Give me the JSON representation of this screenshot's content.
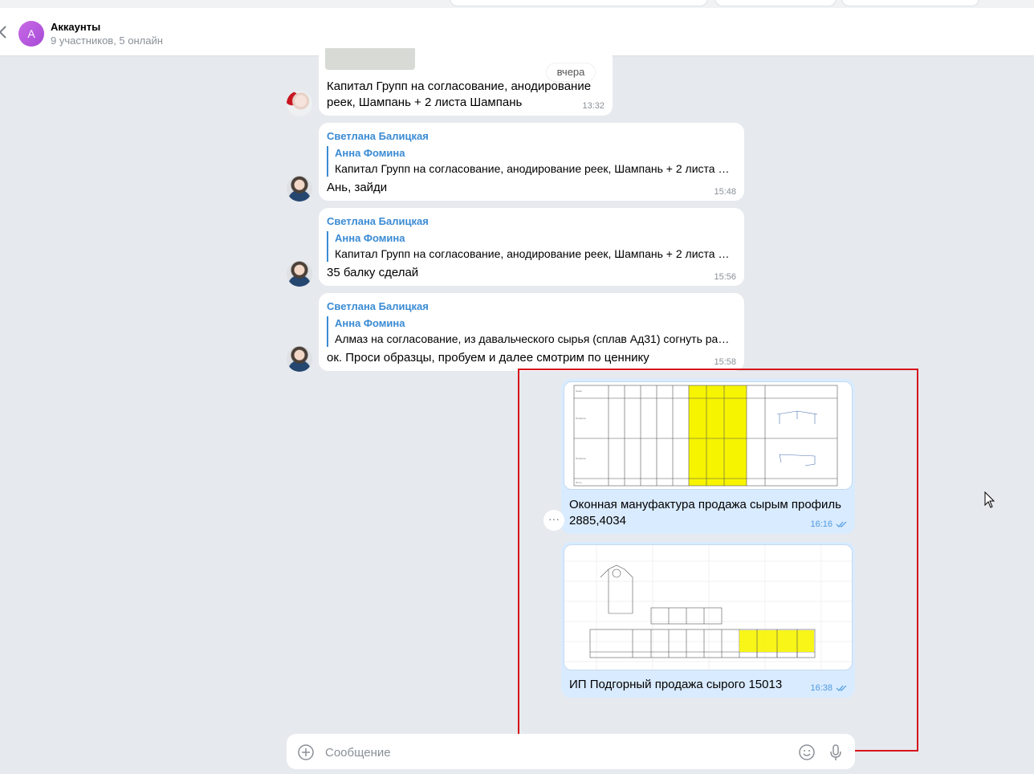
{
  "header": {
    "avatar_letter": "А",
    "title": "Аккаунты",
    "subtitle": "9 участников, 5 онлайн"
  },
  "date_chip": "вчера",
  "messages": [
    {
      "text": "Капитал Групп на согласование, анодирование реек, Шампань + 2 листа Шампань",
      "time": "13:32"
    },
    {
      "sender": "Светлана Балицкая",
      "quote_name": "Анна Фомина",
      "quote_text": "Капитал Групп на согласование, анодирование реек, Шампань + 2 листа Ш...",
      "text": "Ань, зайди",
      "time": "15:48"
    },
    {
      "sender": "Светлана Балицкая",
      "quote_name": "Анна Фомина",
      "quote_text": "Капитал Групп на согласование, анодирование реек, Шампань + 2 листа Ш...",
      "text": "35 балку сделай",
      "time": "15:56"
    },
    {
      "sender": "Светлана Балицкая",
      "quote_name": "Анна Фомина",
      "quote_text": "Алмаз на согласование, из давальческого сырья (сплав Ад31) согнуть рамк...",
      "text": "ок. Проси образцы, пробуем и далее смотрим по ценнику",
      "time": "15:58"
    }
  ],
  "outgoing": [
    {
      "caption": "Оконная мануфактура продажа сырым профиль 2885,4034",
      "time": "16:16"
    },
    {
      "caption": "ИП Подгорный продажа сырого 15013",
      "time": "16:38"
    }
  ],
  "composer": {
    "placeholder": "Сообщение"
  },
  "colors": {
    "accent": "#3a8bd4",
    "outgoing_bubble": "#d9ebff",
    "highlight_frame": "#d6141b",
    "spreadsheet_highlight": "#f7f400"
  },
  "icons": [
    "back-icon",
    "more-icon",
    "read-check-icon",
    "attach-icon",
    "emoji-icon",
    "mic-icon",
    "mouse-cursor-icon"
  ]
}
